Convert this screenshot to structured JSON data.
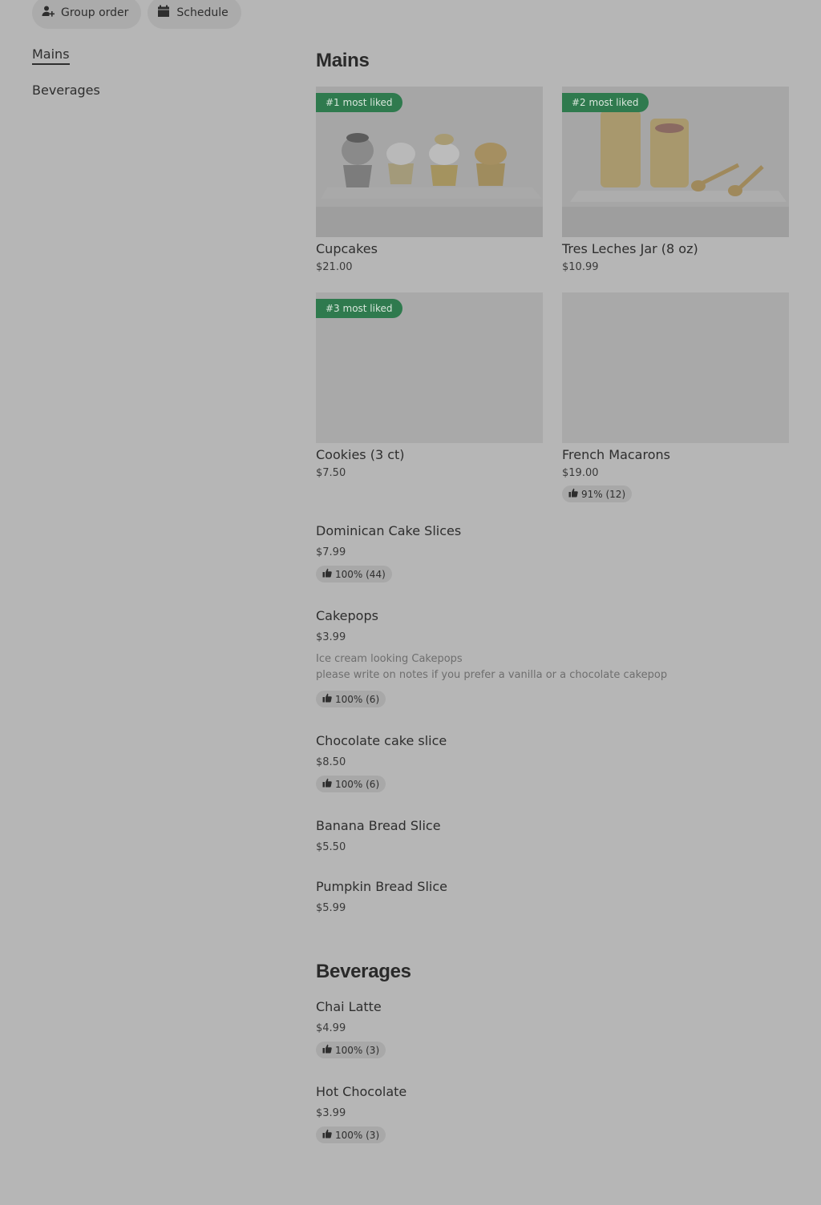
{
  "top_actions": {
    "group_order": "Group order",
    "schedule": "Schedule"
  },
  "categories": [
    {
      "label": "Mains",
      "active": true
    },
    {
      "label": "Beverages",
      "active": false
    }
  ],
  "mains": {
    "title": "Mains",
    "featured": [
      {
        "name": "Cupcakes",
        "price": "$21.00",
        "badge": "#1 most liked"
      },
      {
        "name": "Tres Leches Jar (8 oz)",
        "price": "$10.99",
        "badge": "#2 most liked"
      },
      {
        "name": "Cookies (3 ct)",
        "price": "$7.50",
        "badge": "#3 most liked"
      },
      {
        "name": "French Macarons",
        "price": "$19.00",
        "rating": "91% (12)"
      }
    ],
    "items": [
      {
        "name": "Dominican Cake Slices",
        "price": "$7.99",
        "rating": "100% (44)"
      },
      {
        "name": "Cakepops",
        "price": "$3.99",
        "desc_line1": "Ice cream looking Cakepops",
        "desc_line2": "please write on notes if you prefer a vanilla or a chocolate cakepop",
        "rating": "100% (6)"
      },
      {
        "name": "Chocolate cake slice",
        "price": "$8.50",
        "rating": "100% (6)"
      },
      {
        "name": "Banana Bread Slice",
        "price": "$5.50"
      },
      {
        "name": "Pumpkin Bread Slice",
        "price": "$5.99"
      }
    ]
  },
  "beverages": {
    "title": "Beverages",
    "items": [
      {
        "name": "Chai Latte",
        "price": "$4.99",
        "rating": "100% (3)"
      },
      {
        "name": "Hot Chocolate",
        "price": "$3.99",
        "rating": "100% (3)"
      }
    ]
  },
  "colors": {
    "background": "#b6b6b6",
    "badge_green": "#2f7a4e",
    "pill_bg": "#ababab"
  }
}
